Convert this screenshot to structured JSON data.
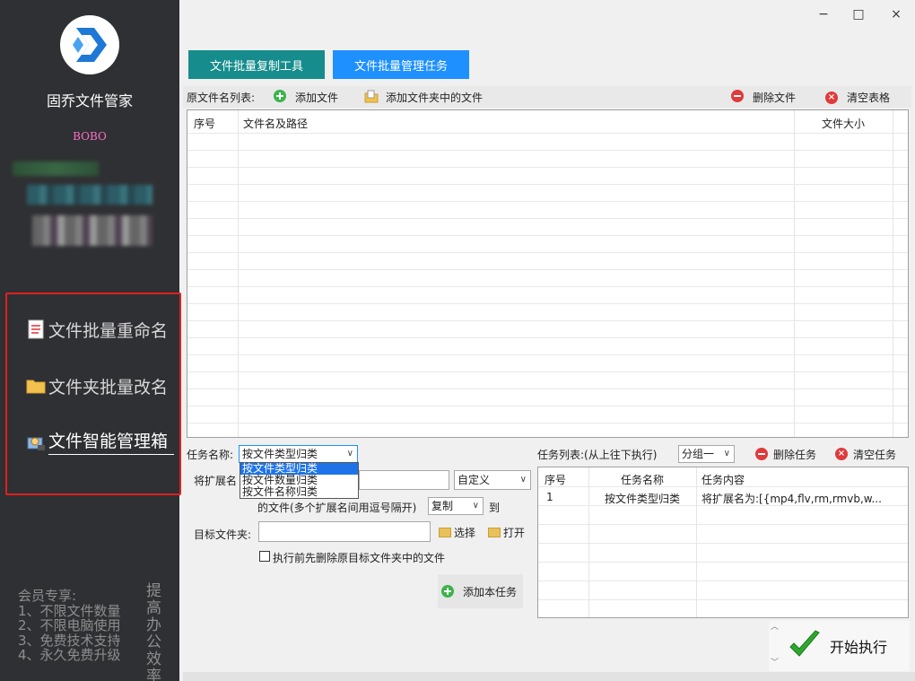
{
  "sidebar": {
    "app_name": "固乔文件管家",
    "user_name": "BOBO",
    "nav": [
      {
        "label": "文件批量重命名",
        "icon": "document-icon"
      },
      {
        "label": "文件夹批量改名",
        "icon": "folder-icon"
      },
      {
        "label": "文件智能管理箱",
        "icon": "toolbox-icon"
      }
    ],
    "member_lines": [
      "会员专享:",
      "1、不限文件数量",
      "2、不限电脑使用",
      "3、免费技术支持",
      "4、永久免费升级"
    ],
    "slogan": "提高办公效率"
  },
  "window": {
    "minimize": "−",
    "maximize": "□",
    "close": "×"
  },
  "tabs": [
    {
      "label": "文件批量复制工具",
      "color": "#168c8c"
    },
    {
      "label": "文件批量管理任务",
      "color": "#1e90ff",
      "active": true
    }
  ],
  "file_list": {
    "label": "原文件名列表:",
    "add_file": "添加文件",
    "add_folder_files": "添加文件夹中的文件",
    "delete_file": "删除文件",
    "clear_table": "清空表格",
    "columns": [
      "序号",
      "文件名及路径",
      "文件大小"
    ]
  },
  "task_form": {
    "task_name_label": "任务名称:",
    "task_name_value": "按文件类型归类",
    "task_options": [
      "按文件类型归类",
      "按文件数量归类",
      "按文件名称归类"
    ],
    "ext_label_prefix": "将扩展名",
    "custom_value": "自定义",
    "ext_hint": "的文件(多个扩展名间用逗号隔开)",
    "action_value": "复制",
    "to_label": "到",
    "target_label": "目标文件夹:",
    "select_btn": "选择",
    "open_btn": "打开",
    "delete_before": "执行前先删除原目标文件夹中的文件",
    "add_task_btn": "添加本任务"
  },
  "task_list": {
    "label": "任务列表:(从上往下执行)",
    "group_value": "分组一",
    "delete_task": "删除任务",
    "clear_task": "清空任务",
    "columns": [
      "序号",
      "任务名称",
      "任务内容"
    ],
    "rows": [
      {
        "index": "1",
        "name": "按文件类型归类",
        "content": "将扩展名为:[{mp4,flv,rm,rmvb,w..."
      }
    ]
  },
  "start_button": "开始执行",
  "colors": {
    "sidebar_bg": "#2f3033",
    "accent_blue": "#1e90ff",
    "accent_teal": "#168c8c",
    "highlight_red": "#e02020",
    "user_pink": "#ff6ec7"
  }
}
